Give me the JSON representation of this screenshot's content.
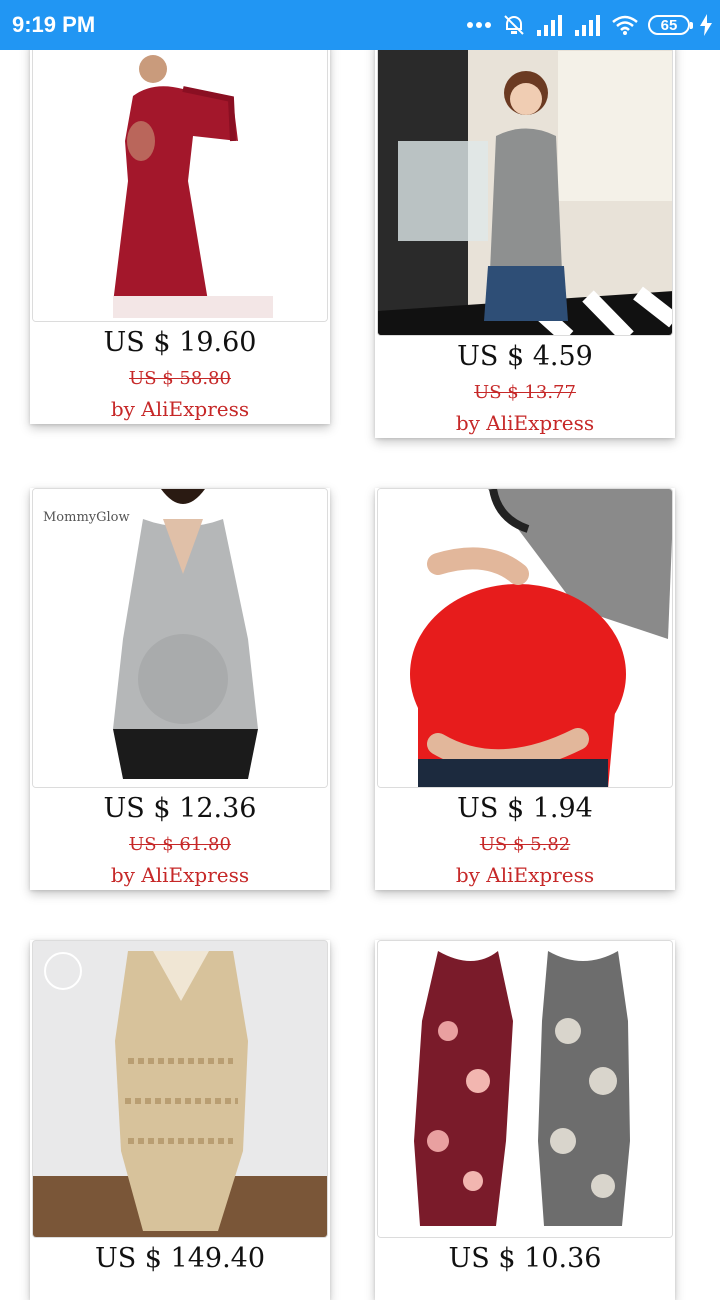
{
  "status": {
    "time": "9:19 PM",
    "battery": "65"
  },
  "products": [
    {
      "price": "US $ 19.60",
      "original_price": "US $ 58.80",
      "seller": "by AliExpress"
    },
    {
      "price": "US $ 4.59",
      "original_price": "US $ 13.77",
      "seller": "by AliExpress"
    },
    {
      "price": "US $ 12.36",
      "original_price": "US $ 61.80",
      "seller": "by AliExpress",
      "image_label": "MommyGlow"
    },
    {
      "price": "US $ 1.94",
      "original_price": "US $ 5.82",
      "seller": "by AliExpress"
    },
    {
      "price": "US $ 149.40"
    },
    {
      "price": "US $ 10.36"
    }
  ]
}
